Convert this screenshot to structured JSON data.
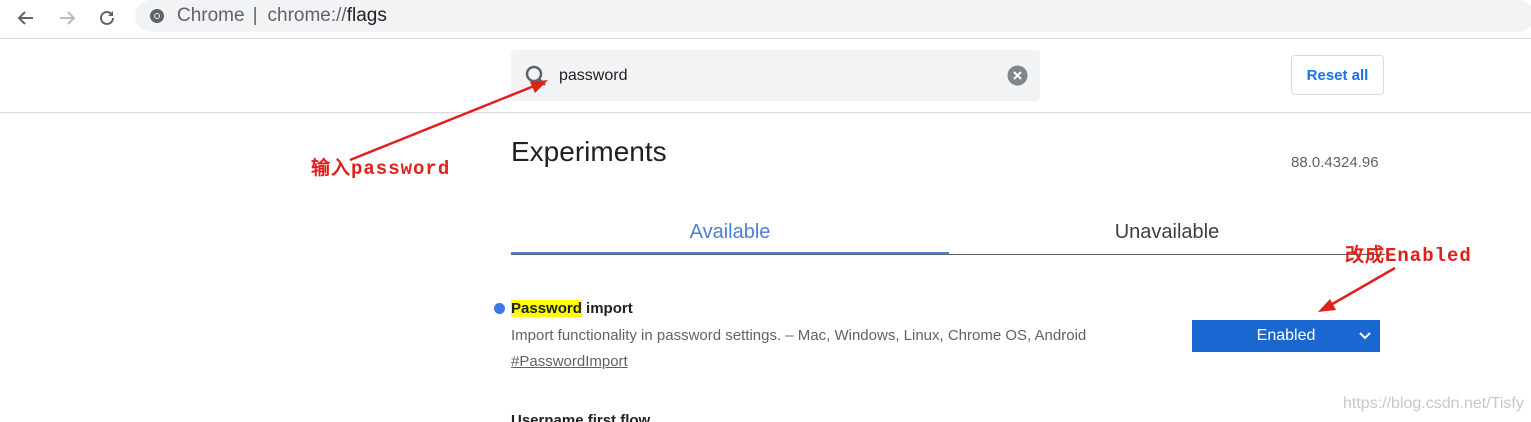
{
  "browser": {
    "site_name": "Chrome",
    "separator": "|",
    "url_prefix": "chrome://",
    "url_path": "flags"
  },
  "search": {
    "value": "password"
  },
  "header": {
    "reset_label": "Reset all"
  },
  "main": {
    "title": "Experiments",
    "version": "88.0.4324.96",
    "tabs": [
      {
        "label": "Available"
      },
      {
        "label": "Unavailable"
      }
    ]
  },
  "experiment": {
    "title_highlight": "Password",
    "title_rest": " import",
    "description": "Import functionality in password settings. – Mac, Windows, Linux, Chrome OS, Android",
    "link": "#PasswordImport",
    "state": "Enabled"
  },
  "next_experiment": {
    "title": "Username first flow"
  },
  "annotations": {
    "input_note": "输入password",
    "change_note": "改成Enabled",
    "color": "#e0201b"
  },
  "watermark": "https://blog.csdn.net/Tisfy"
}
